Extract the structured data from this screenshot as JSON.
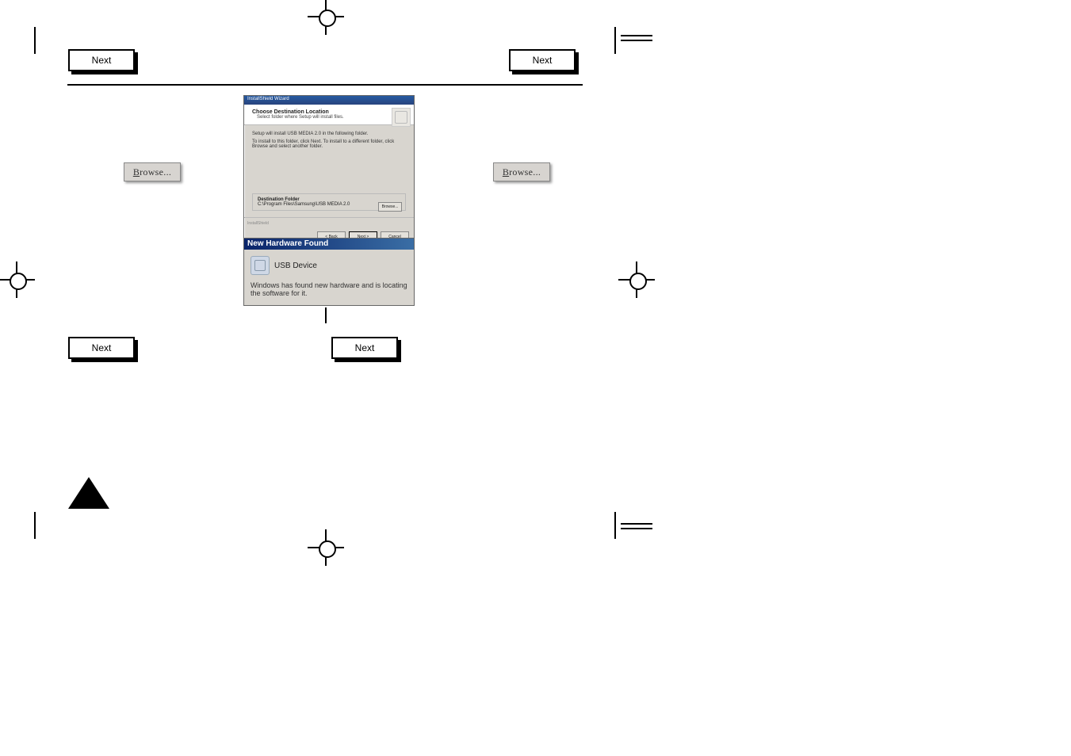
{
  "buttons": {
    "next": "Next",
    "browse_text": "rowse..."
  },
  "wizard": {
    "title": "InstallShield Wizard",
    "heading": "Choose Destination Location",
    "subheading": "Select folder where Setup will install files.",
    "body_line1": "Setup will install USB MEDIA 2.0 in the following folder.",
    "body_line2": "To install to this folder, click Next. To install to a different folder, click Browse and select another folder.",
    "dest_label": "Destination Folder",
    "dest_path": "C:\\Program Files\\Samsung\\USB MEDIA 2.0",
    "mini_browse": "Browse...",
    "brand": "InstallShield",
    "back": "< Back",
    "next": "Next >",
    "cancel": "Cancel"
  },
  "new_hardware": {
    "title": "New Hardware Found",
    "device": "USB Device",
    "message": "Windows has found new hardware and is locating the software for it."
  }
}
